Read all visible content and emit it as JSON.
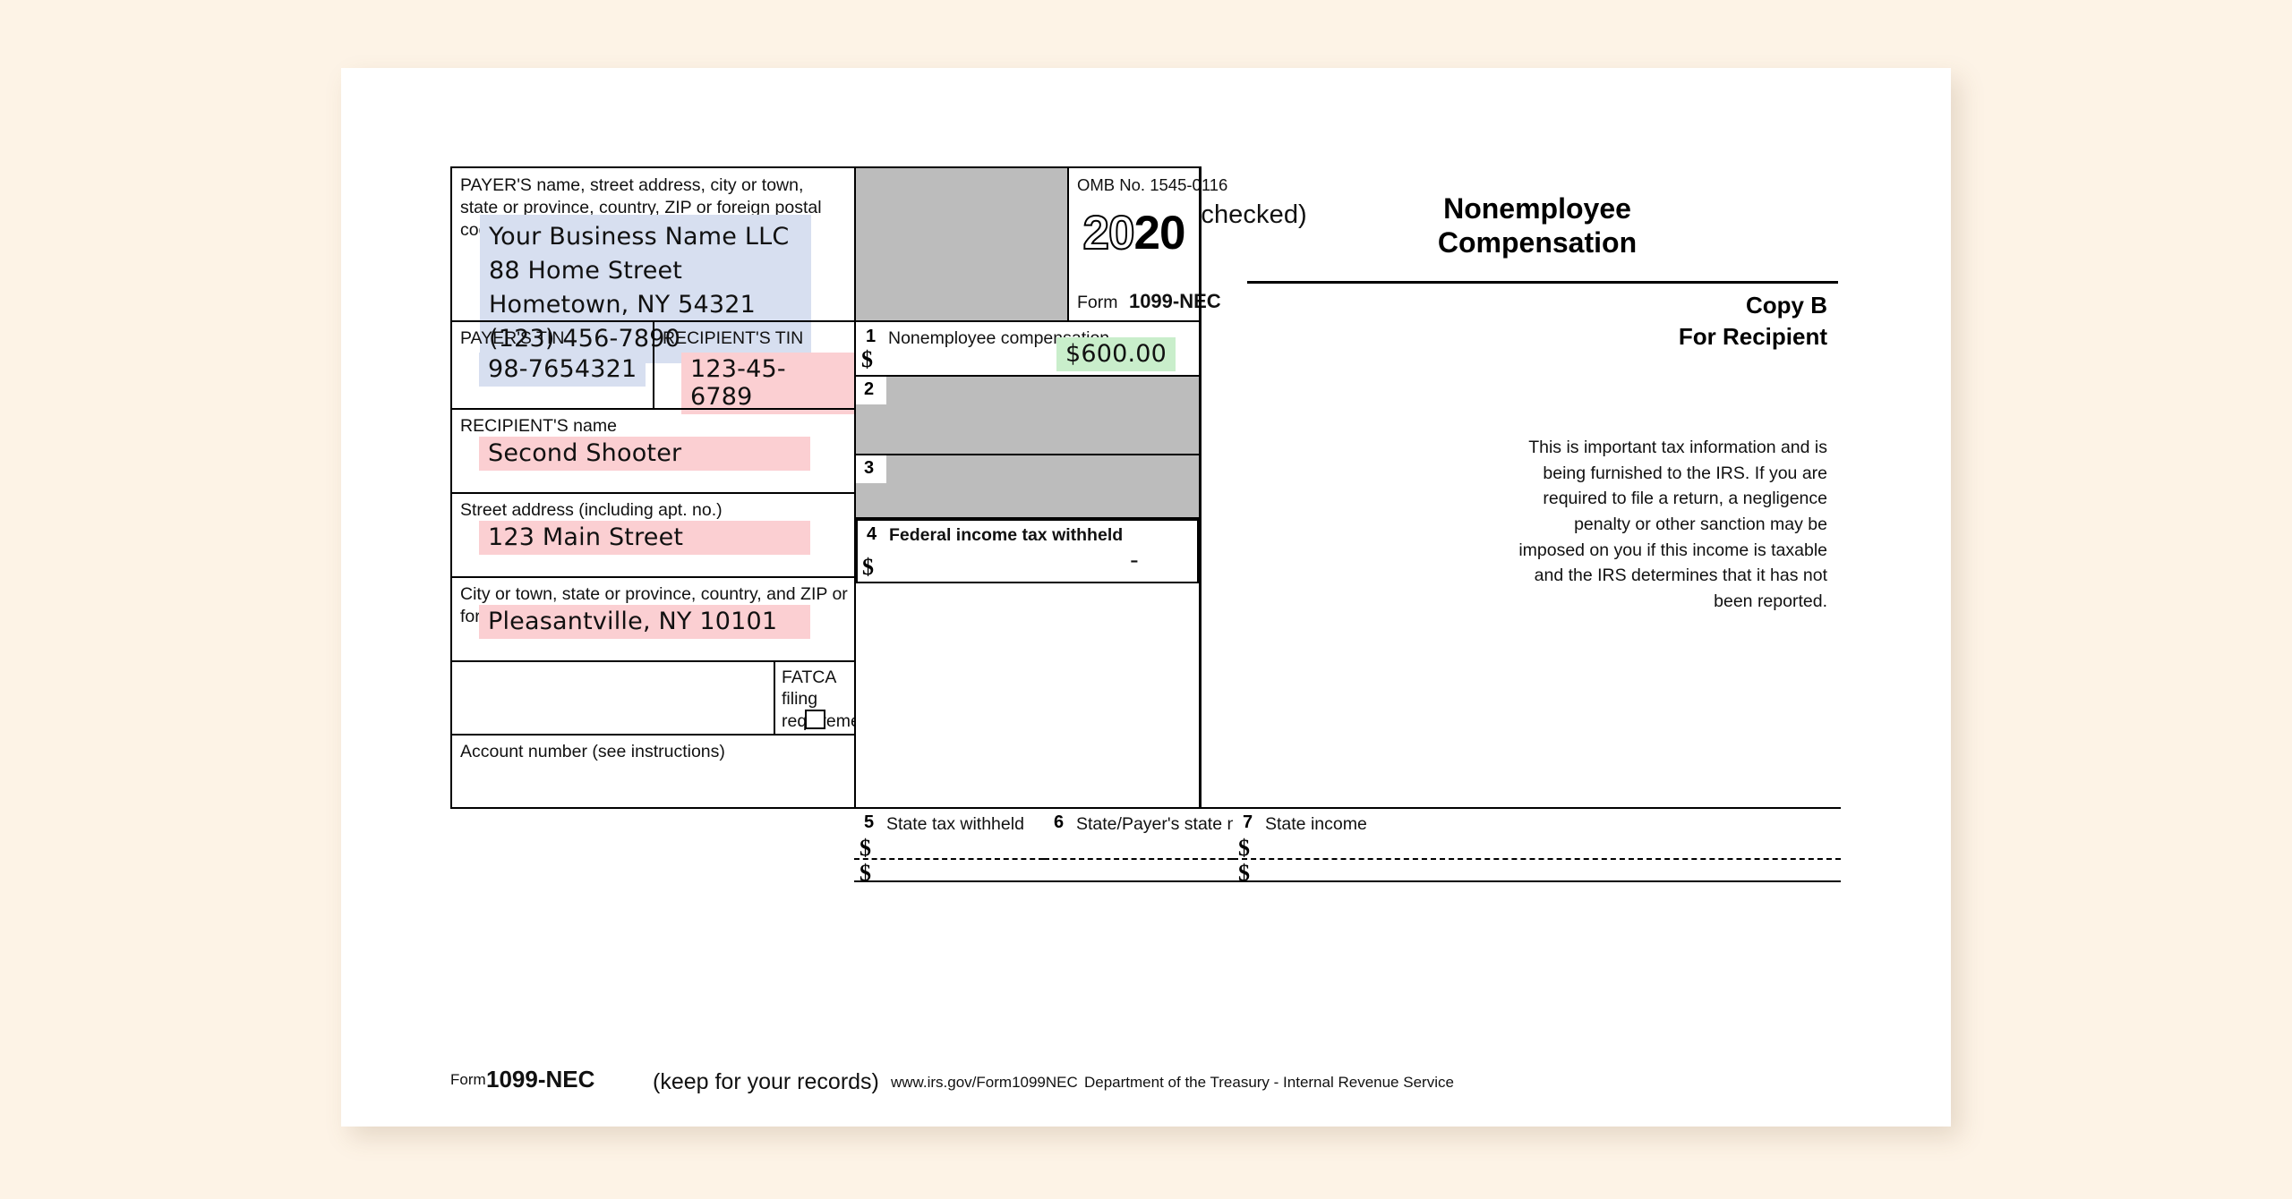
{
  "document": {
    "form_number": "1099-NEC",
    "tax_year_part1": "20",
    "tax_year_part2": "20",
    "corrected_label": "CORRECTED (if checked)",
    "corrected_checked": false,
    "omb_label": "OMB No. 1545-0116",
    "form_prefix": "Form",
    "title_line1": "Nonemployee",
    "title_line2": "Compensation",
    "copy_label": "Copy B",
    "copy_for": "For Recipient",
    "info_text": "This is important tax information and is being furnished to the IRS. If you are required to file a return, a negligence penalty or other sanction may be imposed on you if this income is taxable and the IRS determines that it has not been reported."
  },
  "payer": {
    "block_label": "PAYER'S name, street address, city or town, state or province, country, ZIP or foreign postal code, and telephone no.",
    "name": "Your Business Name LLC",
    "street": "88 Home Street",
    "city_state_zip": "Hometown, NY 54321",
    "phone": "(123) 456-7890",
    "tin_label": "PAYER'S TIN",
    "tin": "98-7654321"
  },
  "recipient": {
    "tin_label": "RECIPIENT'S TIN",
    "tin": "123-45-6789",
    "name_label": "RECIPIENT'S name",
    "name": "Second Shooter",
    "street_label": "Street address (including apt. no.)",
    "street": "123 Main Street",
    "city_label": "City or town, state or province, country, and ZIP or foreign postal code",
    "city_state_zip": "Pleasantville, NY 10101"
  },
  "boxes": {
    "box1": {
      "number": "1",
      "label": "Nonemployee compensation",
      "currency": "$",
      "value": "$600.00"
    },
    "box2": {
      "number": "2",
      "label": "",
      "value": ""
    },
    "box3": {
      "number": "3",
      "label": "",
      "value": ""
    },
    "box4": {
      "number": "4",
      "label": "Federal income tax withheld",
      "currency": "$",
      "value": "-"
    },
    "box5": {
      "number": "5",
      "label": "State tax withheld",
      "currency1": "$",
      "currency2": "$",
      "value1": "",
      "value2": ""
    },
    "box6": {
      "number": "6",
      "label": "State/Payer's state no.",
      "value1": "",
      "value2": ""
    },
    "box7": {
      "number": "7",
      "label": "State income",
      "currency1": "$",
      "currency2": "$",
      "value1": "",
      "value2": ""
    }
  },
  "fatca": {
    "label_line1": "FATCA filing",
    "label_line2": "requirement",
    "checked": false
  },
  "account": {
    "label": "Account number (see instructions)",
    "value": ""
  },
  "footer": {
    "form_prefix": "Form",
    "form_number": "1099-NEC",
    "keep_note": "(keep for your records)",
    "url": "www.irs.gov/Form1099NEC",
    "agency": "Department of the Treasury - Internal Revenue Service"
  },
  "colors": {
    "background": "#fdf3e6",
    "paper": "#ffffff",
    "payer_highlight": "#d7dff0",
    "recipient_highlight": "#fbcfd2",
    "amount_highlight": "#c9eecb",
    "gray_fill": "#bcbcbc",
    "ink": "#000000"
  }
}
